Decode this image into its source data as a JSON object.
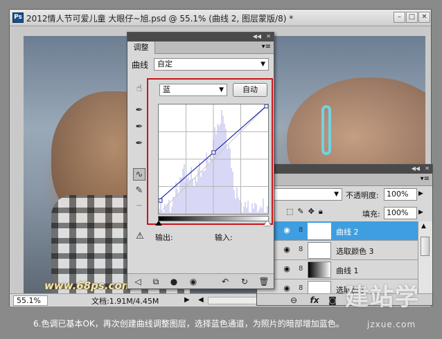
{
  "window": {
    "app_icon": "Ps",
    "title": "2012情人节可爱儿童  大眼仔~旭.psd @ 55.1% (曲线 2, 图层蒙版/8) *",
    "buttons": [
      "minimize-icon",
      "maximize-icon",
      "close-icon"
    ]
  },
  "canvas": {
    "watermark": "www.68ps.com"
  },
  "statusbar": {
    "zoom": "55.1%",
    "doc_size": "文档:1.91M/4.45M"
  },
  "adjustments": {
    "tab": "调整",
    "type_label": "曲线",
    "preset": "自定",
    "channel": "蓝",
    "auto_button": "自动",
    "output_label": "输出:",
    "input_label": "输入:",
    "curve_color": "#1e2aa8",
    "histogram_color": "#d8d8f6",
    "highlight_box_color": "#c8141a",
    "tools": [
      "hand-adjust-icon",
      "black-eyedropper-icon",
      "gray-eyedropper-icon",
      "white-eyedropper-icon",
      "curve-tool-icon",
      "pencil-icon",
      "smooth-icon"
    ],
    "bottom_icons": [
      "back-arrow-icon",
      "clip-icon",
      "visibility-icon",
      "eye-icon",
      "reset-prev-icon",
      "reset-icon",
      "trash-icon"
    ]
  },
  "chart_data": {
    "type": "line",
    "title": "",
    "xlabel": "",
    "ylabel": "",
    "xlim": [
      0,
      255
    ],
    "ylim": [
      0,
      255
    ],
    "grid": "on",
    "series": [
      {
        "x": [
          0,
          128,
          255
        ],
        "y": [
          31,
          143,
          255
        ]
      }
    ]
  },
  "layers": {
    "blend_mode": "常",
    "opacity_label": "不透明度:",
    "opacity": "100%",
    "lock_label": "定:",
    "fill_label": "填充:",
    "fill": "100%",
    "items": [
      {
        "name": "曲线 2",
        "selected": true,
        "thumb": "white"
      },
      {
        "name": "选取颜色 3",
        "selected": false,
        "thumb": "white"
      },
      {
        "name": "曲线 1",
        "selected": false,
        "thumb": "gradient"
      },
      {
        "name": "选取颜色",
        "selected": false,
        "thumb": "white"
      }
    ],
    "bottom_icons": [
      "link-icon",
      "fx-icon",
      "mask-icon"
    ]
  },
  "site_logo": {
    "text": "建站学",
    "url": "jzxue.com"
  },
  "caption": "6.色调已基本OK，再次创建曲线调整图层，选择蓝色通道，为照片的暗部增加蓝色。"
}
